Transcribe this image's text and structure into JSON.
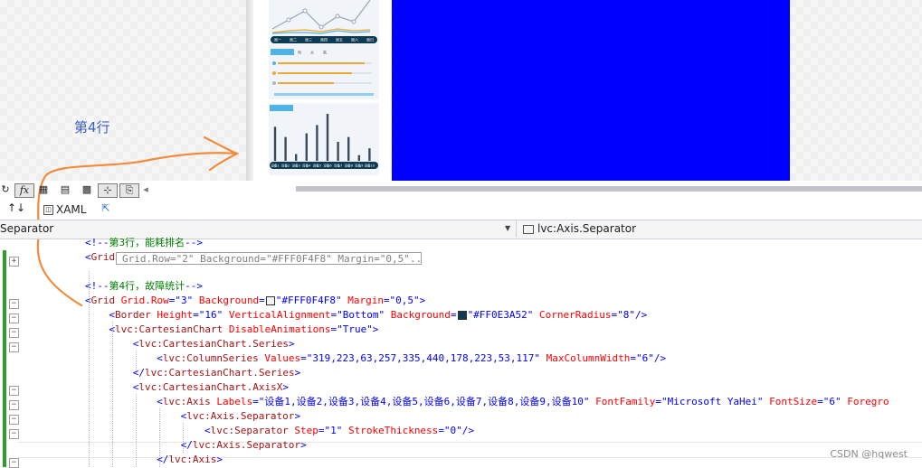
{
  "annotation": {
    "label": "第4行",
    "color": "#3a5fc8"
  },
  "preview": {
    "top_card": {
      "x_labels": [
        "周一",
        "周二",
        "周三",
        "周四",
        "周五",
        "周六",
        "周日"
      ],
      "legend_items": [
        "电",
        "水",
        "氧"
      ]
    },
    "bottom_card": {
      "x_labels": [
        "设备1",
        "设备2",
        "设备3",
        "设备4",
        "设备5",
        "设备6",
        "设备7",
        "设备8",
        "设备9",
        "设备10"
      ]
    },
    "blue_panel_color": "#0000ff"
  },
  "toolbar": {
    "fx_label": "fx",
    "swap_icon_label": "↑↓",
    "xaml_tab_label": "XAML"
  },
  "navbar": {
    "left_value": "Separator",
    "right_value": "lvc:Axis.Separator"
  },
  "code": {
    "collapsed_summary": "Grid.Row=\"2\" Background=\"#FFF0F4F8\" Margin=\"0,5\"...",
    "lines": [
      {
        "indent": "",
        "parts": [
          {
            "c": "c-br",
            "t": "<!--"
          },
          {
            "c": "c-comment",
            "t": "第3行，能耗排名"
          },
          {
            "c": "c-br",
            "t": "-->"
          }
        ]
      },
      {
        "indent": "",
        "parts": [
          {
            "c": "c-br",
            "t": "<"
          },
          {
            "c": "c-tag",
            "t": "Grid"
          }
        ]
      },
      {
        "indent": "",
        "parts": []
      },
      {
        "indent": "",
        "parts": [
          {
            "c": "c-br",
            "t": "<!--"
          },
          {
            "c": "c-comment",
            "t": "第4行，故障统计"
          },
          {
            "c": "c-br",
            "t": "-->"
          }
        ]
      },
      {
        "indent": "",
        "parts": [
          {
            "c": "c-br",
            "t": "<"
          },
          {
            "c": "c-tag",
            "t": "Grid"
          },
          {
            "c": "c-attr",
            "t": " Grid.Row"
          },
          {
            "c": "c-br",
            "t": "=\"3\""
          },
          {
            "c": "c-attr",
            "t": " Background"
          },
          {
            "c": "c-br",
            "t": "="
          },
          {
            "c": "swatch-light",
            "t": ""
          },
          {
            "c": "c-br",
            "t": "\"#FFF0F4F8\""
          },
          {
            "c": "c-attr",
            "t": " Margin"
          },
          {
            "c": "c-br",
            "t": "=\"0,5\">"
          }
        ]
      },
      {
        "indent": "    ",
        "parts": [
          {
            "c": "c-br",
            "t": "<"
          },
          {
            "c": "c-tag",
            "t": "Border"
          },
          {
            "c": "c-attr",
            "t": " Height"
          },
          {
            "c": "c-br",
            "t": "=\"16\""
          },
          {
            "c": "c-attr",
            "t": " VerticalAlignment"
          },
          {
            "c": "c-br",
            "t": "=\"Bottom\""
          },
          {
            "c": "c-attr",
            "t": " Background"
          },
          {
            "c": "c-br",
            "t": "="
          },
          {
            "c": "swatch-dark",
            "t": ""
          },
          {
            "c": "c-br",
            "t": "\"#FF0E3A52\""
          },
          {
            "c": "c-attr",
            "t": " CornerRadius"
          },
          {
            "c": "c-br",
            "t": "=\"8\"/>"
          }
        ]
      },
      {
        "indent": "    ",
        "parts": [
          {
            "c": "c-br",
            "t": "<"
          },
          {
            "c": "c-tag",
            "t": "lvc:CartesianChart"
          },
          {
            "c": "c-attr",
            "t": " DisableAnimations"
          },
          {
            "c": "c-br",
            "t": "=\"True\">"
          }
        ]
      },
      {
        "indent": "        ",
        "parts": [
          {
            "c": "c-br",
            "t": "<"
          },
          {
            "c": "c-tag",
            "t": "lvc:CartesianChart.Series"
          },
          {
            "c": "c-br",
            "t": ">"
          }
        ]
      },
      {
        "indent": "            ",
        "parts": [
          {
            "c": "c-br",
            "t": "<"
          },
          {
            "c": "c-tag",
            "t": "lvc:ColumnSeries"
          },
          {
            "c": "c-attr",
            "t": " Values"
          },
          {
            "c": "c-br",
            "t": "=\"319,223,63,257,335,440,178,223,53,117\""
          },
          {
            "c": "c-attr",
            "t": " MaxColumnWidth"
          },
          {
            "c": "c-br",
            "t": "=\"6\"/>"
          }
        ]
      },
      {
        "indent": "        ",
        "parts": [
          {
            "c": "c-br",
            "t": "</"
          },
          {
            "c": "c-tag",
            "t": "lvc:CartesianChart.Series"
          },
          {
            "c": "c-br",
            "t": ">"
          }
        ]
      },
      {
        "indent": "        ",
        "parts": [
          {
            "c": "c-br",
            "t": "<"
          },
          {
            "c": "c-tag",
            "t": "lvc:CartesianChart.AxisX"
          },
          {
            "c": "c-br",
            "t": ">"
          }
        ]
      },
      {
        "indent": "            ",
        "parts": [
          {
            "c": "c-br",
            "t": "<"
          },
          {
            "c": "c-tag",
            "t": "lvc:Axis"
          },
          {
            "c": "c-attr",
            "t": " Labels"
          },
          {
            "c": "c-br",
            "t": "=\"设备1,设备2,设备3,设备4,设备5,设备6,设备7,设备8,设备9,设备10\""
          },
          {
            "c": "c-attr",
            "t": " FontFamily"
          },
          {
            "c": "c-br",
            "t": "=\"Microsoft YaHei\""
          },
          {
            "c": "c-attr",
            "t": " FontSize"
          },
          {
            "c": "c-br",
            "t": "=\"6\""
          },
          {
            "c": "c-attr",
            "t": " Foregro"
          }
        ]
      },
      {
        "indent": "                ",
        "parts": [
          {
            "c": "c-br",
            "t": "<"
          },
          {
            "c": "c-tag",
            "t": "lvc:Axis.Separator"
          },
          {
            "c": "c-br",
            "t": ">"
          }
        ]
      },
      {
        "indent": "                    ",
        "parts": [
          {
            "c": "c-br",
            "t": "<"
          },
          {
            "c": "c-tag",
            "t": "lvc:Separator"
          },
          {
            "c": "c-attr",
            "t": " Step"
          },
          {
            "c": "c-br",
            "t": "=\"1\""
          },
          {
            "c": "c-attr",
            "t": " StrokeThickness"
          },
          {
            "c": "c-br",
            "t": "=\"0\"/>"
          }
        ]
      },
      {
        "indent": "                ",
        "parts": [
          {
            "c": "c-br",
            "t": "</"
          },
          {
            "c": "c-tag",
            "t": "lvc:Axis.Separator"
          },
          {
            "c": "c-br",
            "t": ">"
          }
        ]
      },
      {
        "indent": "            ",
        "parts": [
          {
            "c": "c-br",
            "t": "</"
          },
          {
            "c": "c-tag",
            "t": "lvc:Axis"
          },
          {
            "c": "c-br",
            "t": ">"
          }
        ]
      }
    ]
  },
  "watermark": "CSDN @hqwest"
}
